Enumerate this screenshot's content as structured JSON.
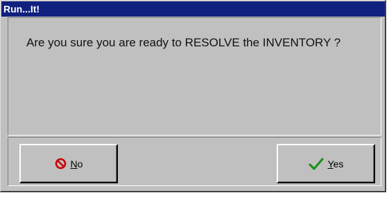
{
  "window": {
    "title": "Run...It!"
  },
  "message": "Are you sure you are ready to RESOLVE the INVENTORY ?",
  "buttons": {
    "no": {
      "label": "No",
      "icon": "prohibited-icon",
      "icon_color": "#cc0000"
    },
    "yes": {
      "label": "Yes",
      "icon": "checkmark-icon",
      "icon_color": "#1f8f1f"
    }
  },
  "colors": {
    "titlebar": "#10207f",
    "dialog_face": "#c0c0c0"
  }
}
